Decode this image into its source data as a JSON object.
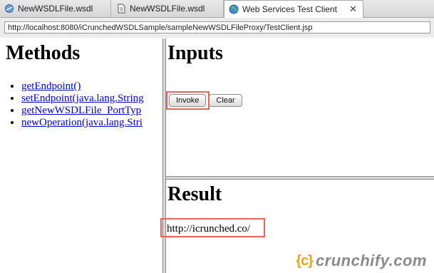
{
  "tabs": [
    {
      "label": "NewWSDLFile.wsdl",
      "icon": "wsdl-file-icon",
      "active": false
    },
    {
      "label": "NewWSDLFile.wsdl",
      "icon": "document-icon",
      "active": false
    },
    {
      "label": "Web Services Test Client",
      "icon": "globe-icon",
      "active": true,
      "close": "✕"
    }
  ],
  "address_bar": {
    "url": "http://localhost:8080/iCrunchedWSDLSample/sampleNewWSDLFileProxy/TestClient.jsp"
  },
  "methods": {
    "title": "Methods",
    "items": [
      "getEndpoint()",
      "setEndpoint(java.lang.String",
      "getNewWSDLFile_PortTyp",
      "newOperation(java.lang.Stri"
    ]
  },
  "inputs": {
    "title": "Inputs",
    "invoke_label": "Invoke",
    "clear_label": "Clear"
  },
  "result": {
    "title": "Result",
    "value": "http://icrunched.co/"
  },
  "watermark": {
    "badge": "{c}",
    "text": "crunchify.com"
  },
  "colors": {
    "highlight": "#e2675a",
    "link": "#0000cc",
    "watermark_accent": "#f0a020"
  }
}
